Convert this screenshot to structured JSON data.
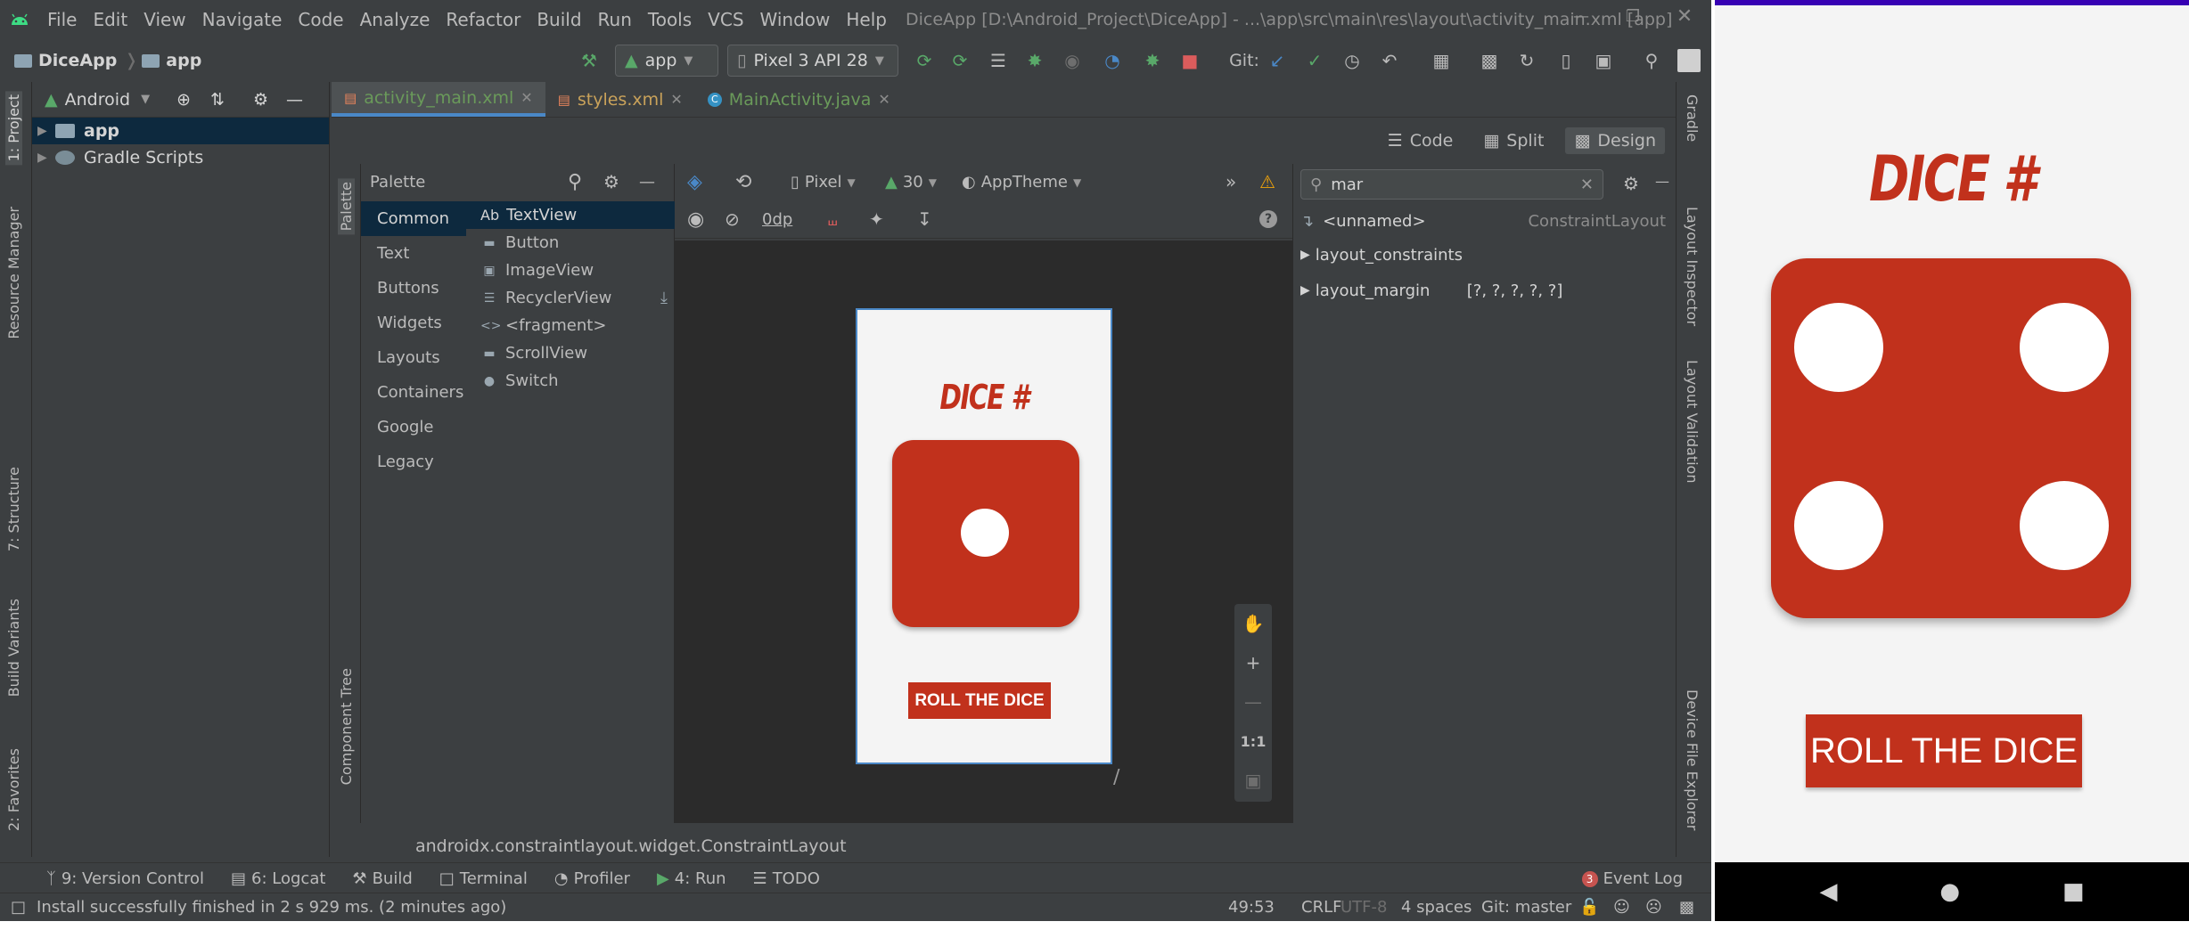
{
  "window": {
    "title": "DiceApp [D:\\Android_Project\\DiceApp] - ...\\app\\src\\main\\res\\layout\\activity_main.xml [app]",
    "menu": [
      "File",
      "Edit",
      "View",
      "Navigate",
      "Code",
      "Analyze",
      "Refactor",
      "Build",
      "Run",
      "Tools",
      "VCS",
      "Window",
      "Help"
    ]
  },
  "navbar": {
    "project": "DiceApp",
    "module": "app",
    "run_config": "app",
    "device": "Pixel 3 API 28",
    "git_label": "Git:"
  },
  "left_strip": {
    "tabs": [
      "1: Project",
      "Resource Manager",
      "7: Structure",
      "Build Variants",
      "2: Favorites"
    ]
  },
  "project_panel": {
    "view_mode": "Android",
    "items": [
      {
        "label": "app"
      },
      {
        "label": "Gradle Scripts"
      }
    ]
  },
  "editor_tabs": [
    "activity_main.xml",
    "styles.xml",
    "MainActivity.java"
  ],
  "design_modes": [
    "Code",
    "Split",
    "Design"
  ],
  "palette": {
    "title": "Palette",
    "categories": [
      "Common",
      "Text",
      "Buttons",
      "Widgets",
      "Layouts",
      "Containers",
      "Google",
      "Legacy"
    ],
    "items": [
      "TextView",
      "Button",
      "ImageView",
      "RecyclerView",
      "<fragment>",
      "ScrollView",
      "Switch"
    ],
    "textview_prefix": "Ab"
  },
  "canvas_toolbar": {
    "device": "Pixel",
    "api": "30",
    "theme": "AppTheme",
    "margin": "0dp"
  },
  "preview": {
    "title": "DICE #",
    "button": "ROLL THE DICE"
  },
  "zoom": {
    "ratio": "1:1"
  },
  "attributes": {
    "search": "mar",
    "component": "<unnamed>",
    "component_type": "ConstraintLayout",
    "rows": [
      {
        "name": "layout_constraints",
        "value": ""
      },
      {
        "name": "layout_margin",
        "value": "[?, ?, ?, ?, ?]"
      }
    ]
  },
  "right_strip": {
    "tabs": [
      "Gradle",
      "Layout Inspector",
      "Layout Validation",
      "Device File Explorer"
    ]
  },
  "component_tree_label": "Component Tree",
  "palette_strip_label": "Palette",
  "class_path": "androidx.constraintlayout.widget.ConstraintLayout",
  "bottom_tools": [
    {
      "label": "9: Version Control"
    },
    {
      "label": "6: Logcat"
    },
    {
      "label": "Build"
    },
    {
      "label": "Terminal"
    },
    {
      "label": "Profiler"
    },
    {
      "label": "4: Run"
    },
    {
      "label": "TODO"
    }
  ],
  "event_log": {
    "count": "3",
    "label": "Event Log"
  },
  "statusbar": {
    "message": "Install successfully finished in 2 s 929 ms. (2 minutes ago)",
    "position": "49:53",
    "line_sep": "CRLF",
    "encoding": "UTF-8",
    "indent": "4 spaces",
    "branch": "Git: master"
  },
  "emulator": {
    "title": "DICE #",
    "button": "ROLL THE DICE"
  },
  "colors": {
    "ide_bg": "#3c3f41",
    "canvas_bg": "#2b2b2b",
    "dice_red": "#c1311c",
    "selection": "#0d293e",
    "accent_blue": "#4a88c7",
    "emulator_topbar": "#3700b3"
  }
}
